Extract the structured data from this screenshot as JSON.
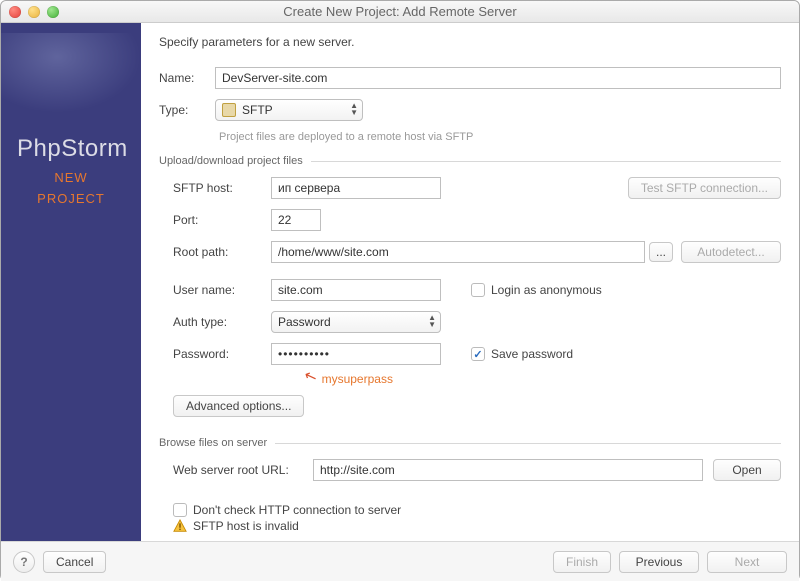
{
  "window": {
    "title": "Create New Project: Add Remote Server"
  },
  "sidebar": {
    "product": "PhpStorm",
    "line1": "NEW",
    "line2": "PROJECT"
  },
  "intro": "Specify parameters for a new server.",
  "name": {
    "label": "Name:",
    "value": "DevServer-site.com"
  },
  "type": {
    "label": "Type:",
    "value": "SFTP",
    "hint": "Project files are deployed to a remote host via SFTP"
  },
  "upload": {
    "legend": "Upload/download project files",
    "sftp_host": {
      "label": "SFTP host:",
      "value": "ип сервера"
    },
    "test_btn": "Test SFTP connection...",
    "port": {
      "label": "Port:",
      "value": "22"
    },
    "root_path": {
      "label": "Root path:",
      "value": "/home/www/site.com",
      "browse": "...",
      "autodetect": "Autodetect..."
    },
    "user": {
      "label": "User name:",
      "value": "site.com",
      "anon_label": "Login as anonymous"
    },
    "auth": {
      "label": "Auth type:",
      "value": "Password"
    },
    "password": {
      "label": "Password:",
      "dots": "••••••••••",
      "save_label": "Save password",
      "annotation": "mysuperpass"
    },
    "advanced": "Advanced options..."
  },
  "browse": {
    "legend": "Browse files on server",
    "url_label": "Web server root URL:",
    "url_value": "http://site.com",
    "open": "Open",
    "dont_check": "Don't check HTTP connection to server",
    "warning": "SFTP host is invalid"
  },
  "footer": {
    "cancel": "Cancel",
    "finish": "Finish",
    "previous": "Previous",
    "next": "Next"
  }
}
